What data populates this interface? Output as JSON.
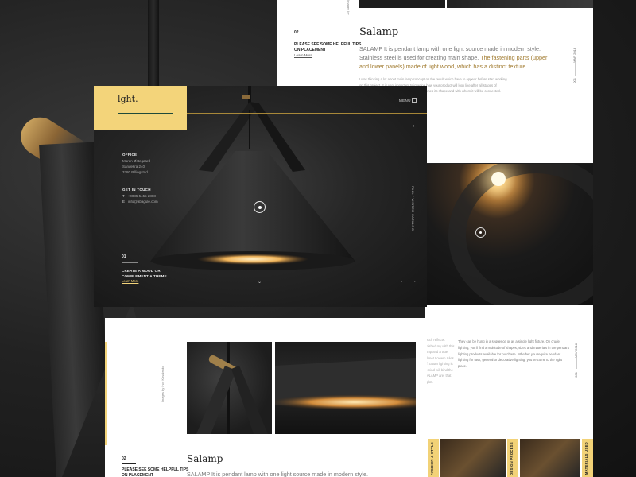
{
  "brand": {
    "logo": "lght.",
    "accent": "#f3d47a"
  },
  "nav": {
    "menu_label": "MENU"
  },
  "office": {
    "heading": "OFFICE",
    "lines": [
      "Maren Østegaard",
      "Sandekra 240",
      "3380 Billingstad"
    ]
  },
  "get_in_touch": {
    "heading": "GET IN TOUCH",
    "phone_label": "T",
    "phone": "+0085 5455 2888",
    "email_label": "E",
    "email": "info@abagule.com"
  },
  "hero": {
    "number": "01",
    "cta": "CREATE A MOOD OR COMPLEMENT A THEME",
    "learn_more": "Learn More",
    "side_text": "FALL / WINTER CATALOG",
    "scroll_icon": "⌄",
    "up_icon": "‹",
    "prev_icon": "←",
    "next_icon": "→"
  },
  "top_page": {
    "strip_label": "Images by",
    "number": "02",
    "tip": "PLEASE SEE SOME HELPFUL TIPS ON PLACEMENT",
    "learn_more": "Learn More",
    "title": "Salamp",
    "body_plain": "SALAMP It is pendant lamp with one light source made in modern style. Stainless steel is used for creating main shape. ",
    "body_highlight": "The fastening parts (upper and lower panels) made of light wood, which has a distinct texture.",
    "small_text": "I was thinking a lot about main lamp concept on the result which have to appear before start working on this project. It is very important to imagine how your product will look like after all stages of development. On the basis of this research comes its shape and with whom it will be connected. Simply and discard inappropriate ideas.",
    "side_top": "MAR 2018",
    "side_bottom": "001"
  },
  "bottom_right_page": {
    "clip_text": "much reflects. finished my with this lamp and a true Planet Lowem rules of Saturn lighting is remind will bind the SALAMP are. that lights.",
    "body": "They can be hung in a sequence or as a single light fixture. On crude lighting, you'll find a multitude of shapes, sizes and materials in the pendant lighting products available for purchase. Whether you require pendant lighting for task, general or decorative lighting, you've come to the right place.",
    "side_top": "MAY 2018",
    "side_bottom": "001",
    "categories": [
      "FASHION & STYLE",
      "DESIGN PROCESS",
      "MATERIALS USED"
    ]
  },
  "bottom_left_page": {
    "credit": "Images by Ihor Kovalenko",
    "number": "02",
    "tip": "PLEASE SEE SOME HELPFUL TIPS ON PLACEMENT",
    "title": "Salamp",
    "body": "SALAMP It is pendant lamp with one light source made in modern style."
  }
}
